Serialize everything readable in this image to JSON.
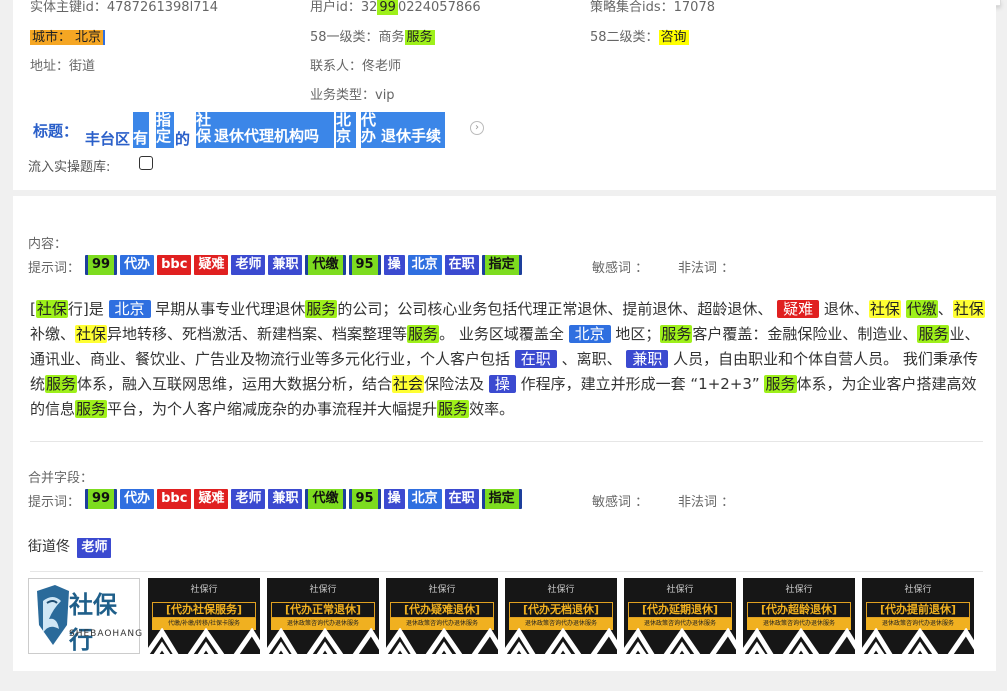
{
  "record": {
    "entity_id_label": "实体主键id：4787261398l714",
    "user_id_prefix": "用户id：32",
    "user_id_hl": "99",
    "user_id_suffix": "0224057866",
    "strategy_label": "策略集合ids：17078",
    "city_label": "城市：",
    "city_value": "北京",
    "cat1_label": "58一级类：商务",
    "cat1_value": "服务",
    "cat2_label": "58二级类：",
    "cat2_value": "咨询",
    "address": "地址：街道",
    "contact": "联系人：佟老师",
    "business_type": "业务类型：vip"
  },
  "title": {
    "label": "标题：",
    "p1": "丰台区",
    "s1": "有",
    "s2a": "指",
    "s2b": "定",
    "p2": "的",
    "s3a": "社",
    "s3b": "保",
    "s4": "退休代理机构吗",
    "s5a": "北",
    "s5b": "京",
    "s6a": "代",
    "s6b": "办",
    "s7": "退休手续"
  },
  "flow_label": "流入实操题库:",
  "content": {
    "label": "内容：",
    "hint_label": "提示词：",
    "sensitive_label": "敏感词 ：",
    "illegal_label": "非法词 ："
  },
  "tags": [
    {
      "text": "99",
      "color": "green"
    },
    {
      "text": "代办",
      "color": "blue"
    },
    {
      "text": "bbc",
      "color": "red"
    },
    {
      "text": "疑难",
      "color": "red"
    },
    {
      "text": "老师",
      "color": "navy"
    },
    {
      "text": "兼职",
      "color": "navy"
    },
    {
      "text": "代缴",
      "color": "green"
    },
    {
      "text": "95",
      "color": "green"
    },
    {
      "text": "操",
      "color": "navy"
    },
    {
      "text": "北京",
      "color": "blue"
    },
    {
      "text": "在职",
      "color": "navy"
    },
    {
      "text": "指定",
      "color": "green"
    }
  ],
  "paragraph": [
    {
      "t": "[",
      "c": ""
    },
    {
      "t": "社保",
      "c": "green"
    },
    {
      "t": "行]是 ",
      "c": ""
    },
    {
      "t": "北京",
      "c": "blue"
    },
    {
      "t": " 早期从事专业代理退休",
      "c": ""
    },
    {
      "t": "服务",
      "c": "green"
    },
    {
      "t": "的公司；公司核心业务包括代理正常退休、提前退休、超龄退休、 ",
      "c": ""
    },
    {
      "t": "疑难",
      "c": "red"
    },
    {
      "t": " 退休、",
      "c": ""
    },
    {
      "t": "社保",
      "c": "yellow"
    },
    {
      "t": " ",
      "c": ""
    },
    {
      "t": "代缴",
      "c": "green"
    },
    {
      "t": "、",
      "c": ""
    },
    {
      "t": "社保",
      "c": "yellow"
    },
    {
      "t": "补缴、",
      "c": ""
    },
    {
      "t": "社保",
      "c": "yellow"
    },
    {
      "t": "异地转移、死档激活、新建档案、档案整理等",
      "c": ""
    },
    {
      "t": "服务",
      "c": "green"
    },
    {
      "t": "。 业务区域覆盖全 ",
      "c": ""
    },
    {
      "t": "北京",
      "c": "blue"
    },
    {
      "t": " 地区；",
      "c": ""
    },
    {
      "t": "服务",
      "c": "green"
    },
    {
      "t": "客户覆盖：金融保险业、制造业、",
      "c": ""
    },
    {
      "t": "服务",
      "c": "green"
    },
    {
      "t": "业、通讯业、商业、餐饮业、广告业及物流行业等多元化行业，个人客户包括 ",
      "c": ""
    },
    {
      "t": "在职",
      "c": "navy"
    },
    {
      "t": " 、离职、 ",
      "c": ""
    },
    {
      "t": "兼职",
      "c": "navy"
    },
    {
      "t": " 人员，自由职业和个体自营人员。 我们秉承传统",
      "c": ""
    },
    {
      "t": "服务",
      "c": "green"
    },
    {
      "t": "体系，融入互联网思维，运用大数据分析，结合",
      "c": ""
    },
    {
      "t": "社会",
      "c": "yellow"
    },
    {
      "t": "保险法及 ",
      "c": ""
    },
    {
      "t": "操",
      "c": "navy"
    },
    {
      "t": " 作程序，建立并形成一套 “1+2+3” ",
      "c": ""
    },
    {
      "t": "服务",
      "c": "green"
    },
    {
      "t": "体系，为企业客户搭建高效的信息",
      "c": ""
    },
    {
      "t": "服务",
      "c": "green"
    },
    {
      "t": "平台，为个人客户缩减庞杂的办事流程并大幅提升",
      "c": ""
    },
    {
      "t": "服务",
      "c": "green"
    },
    {
      "t": "效率。",
      "c": ""
    }
  ],
  "merge": {
    "label": "合并字段：",
    "hint_label": "提示词：",
    "sensitive_label": "敏感词 ：",
    "illegal_label": "非法词 ："
  },
  "street": {
    "text": "街道佟",
    "tag": "老师"
  },
  "logo": {
    "name": "社保行",
    "sub": "SHEBAOHANG"
  },
  "thumbnails": [
    {
      "brand": "社保行",
      "title": "[代办社保服务]",
      "sub": "代缴/补缴/转移/社保卡服务"
    },
    {
      "brand": "社保行",
      "title": "[代办正常退休]",
      "sub": "退休政策咨询代办退休服务"
    },
    {
      "brand": "社保行",
      "title": "[代办疑难退休]",
      "sub": "退休政策咨询代办退休服务"
    },
    {
      "brand": "社保行",
      "title": "[代办无档退休]",
      "sub": "退休政策咨询代办退休服务"
    },
    {
      "brand": "社保行",
      "title": "[代办延期退休]",
      "sub": "退休政策咨询代办退休服务"
    },
    {
      "brand": "社保行",
      "title": "[代办超龄退休]",
      "sub": "退休政策咨询代办退休服务"
    },
    {
      "brand": "社保行",
      "title": "[代办提前退休]",
      "sub": "退休政策咨询代办退休服务"
    }
  ]
}
